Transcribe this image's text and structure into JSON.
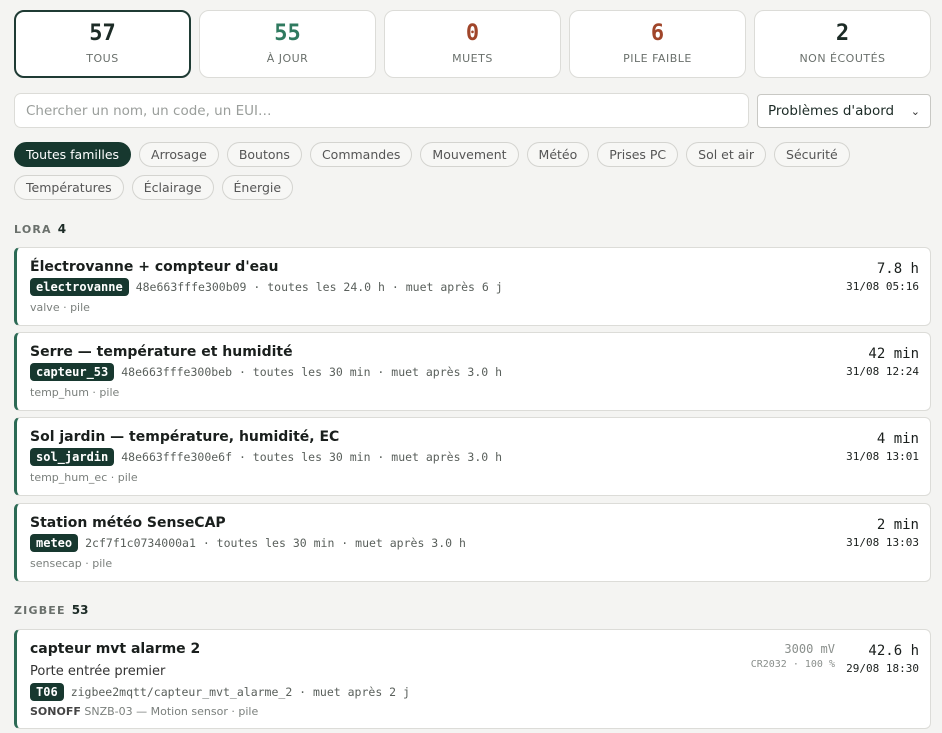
{
  "colors": {
    "accent": "#17382f",
    "ok": "#2f7a5f",
    "warn": "#a0452a",
    "border_left": "#2c6a55"
  },
  "stats": [
    {
      "value": "57",
      "label": "TOUS",
      "color": "#1c2b26"
    },
    {
      "value": "55",
      "label": "À JOUR",
      "color": "#2f7a5f"
    },
    {
      "value": "0",
      "label": "MUETS",
      "color": "#a0452a"
    },
    {
      "value": "6",
      "label": "PILE FAIBLE",
      "color": "#a0452a"
    },
    {
      "value": "2",
      "label": "NON ÉCOUTÉS",
      "color": "#1c2b26"
    }
  ],
  "search": {
    "placeholder": "Chercher un nom, un code, un EUI…"
  },
  "sort": {
    "selected": "Problèmes d'abord",
    "icon": "chevron-down-icon"
  },
  "families": [
    "Toutes familles",
    "Arrosage",
    "Boutons",
    "Commandes",
    "Mouvement",
    "Météo",
    "Prises PC",
    "Sol et air",
    "Sécurité",
    "Températures",
    "Éclairage",
    "Énergie"
  ],
  "groups": {
    "lora": {
      "label": "LORA",
      "count": "4"
    },
    "zigbee": {
      "label": "ZIGBEE",
      "count": "53"
    }
  },
  "lora_devices": [
    {
      "title": "Électrovanne + compteur d'eau",
      "tag": "electrovanne",
      "info": "48e663fffe300b09 · toutes les 24.0 h · muet après 6 j",
      "sub": "valve · pile",
      "dur": "7.8 h",
      "date": "31/08 05:16"
    },
    {
      "title": "Serre — température et humidité",
      "tag": "capteur_53",
      "info": "48e663fffe300beb · toutes les 30 min · muet après 3.0 h",
      "sub": "temp_hum · pile",
      "dur": "42 min",
      "date": "31/08 12:24"
    },
    {
      "title": "Sol jardin — température, humidité, EC",
      "tag": "sol_jardin",
      "info": "48e663fffe300e6f · toutes les 30 min · muet après 3.0 h",
      "sub": "temp_hum_ec · pile",
      "dur": "4 min",
      "date": "31/08 13:01"
    },
    {
      "title": "Station météo SenseCAP",
      "tag": "meteo",
      "info": "2cf7f1c0734000a1 · toutes les 30 min · muet après 3.0 h",
      "sub": "sensecap · pile",
      "dur": "2 min",
      "date": "31/08 13:03"
    }
  ],
  "zigbee_device": {
    "title": "capteur mvt alarme 2",
    "desc": "Porte entrée premier",
    "tag": "T06",
    "info": "zigbee2mqtt/capteur_mvt_alarme_2 · muet après 2 j",
    "brand": "SONOFF",
    "sub": "SNZB-03 — Motion sensor · pile",
    "mv": "3000 mV",
    "batt": "CR2032 · 100 %",
    "dur": "42.6 h",
    "date": "29/08 18:30"
  }
}
